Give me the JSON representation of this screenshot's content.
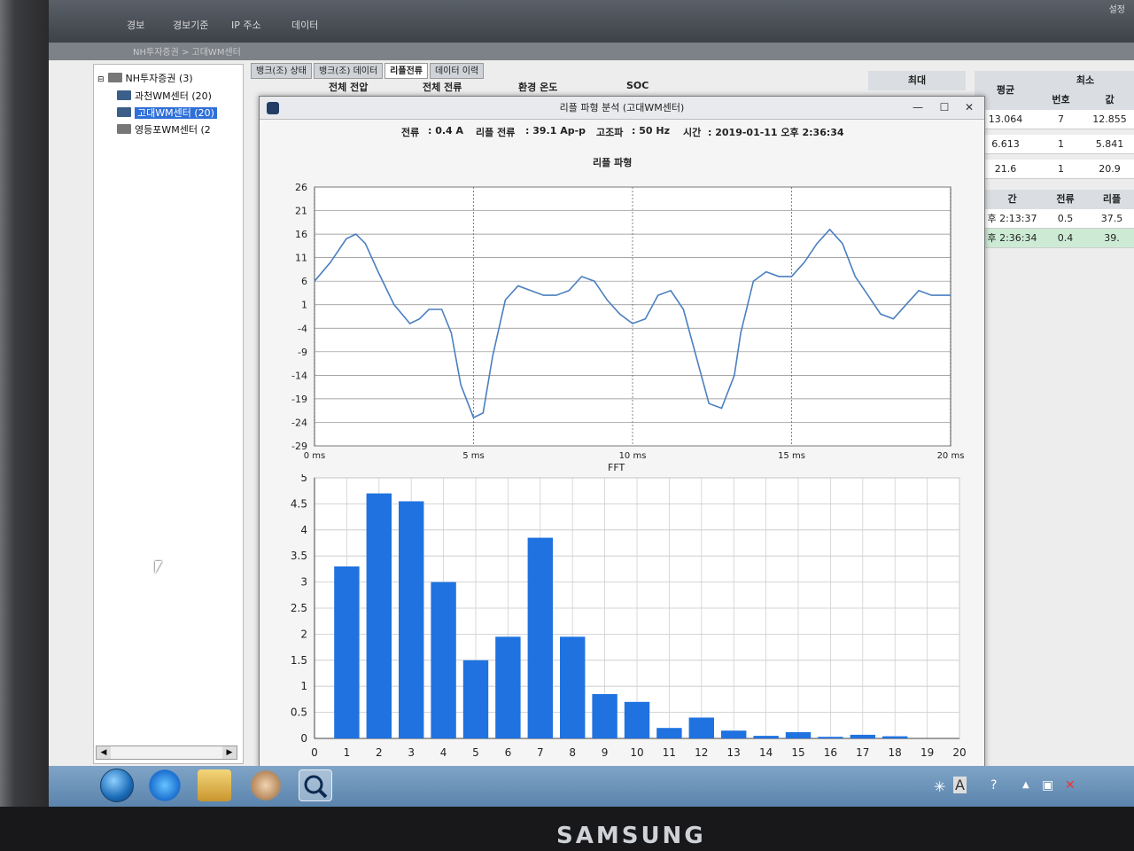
{
  "topbar": {
    "menu": [
      "경보",
      "경보기준",
      "IP 주소",
      "데이터"
    ],
    "settings": "설정"
  },
  "breadcrumb": "NH투자증권 > 고대WM센터",
  "tree": {
    "root": "NH투자증권 (3)",
    "children": [
      "과천WM센터 (20)",
      "고대WM센터 (20)",
      "영등포WM센터 (2"
    ]
  },
  "tabs": [
    "뱅크(조) 상태",
    "뱅크(조) 데이터",
    "리플전류",
    "데이터 이력"
  ],
  "column_headers": [
    "전체 전압",
    "전체 전류",
    "환경 온도",
    "SOC"
  ],
  "right_table": {
    "headers": [
      "최대",
      "평균",
      "최소",
      "번호",
      "값"
    ],
    "rows": [
      {
        "avg": "13.064",
        "no": "7",
        "val": "12.855"
      },
      {
        "avg": "6.613",
        "no": "1",
        "val": "5.841"
      },
      {
        "avg": "21.6",
        "no": "1",
        "val": "20.9"
      }
    ],
    "history_headers": [
      "간",
      "전류",
      "리플"
    ],
    "history_rows": [
      {
        "time": "후 2:13:37",
        "current": "0.5",
        "ripple": "37.5"
      },
      {
        "time": "후 2:36:34",
        "current": "0.4",
        "ripple": "39."
      }
    ]
  },
  "dialog": {
    "title": "리플 파형 분석 (고대WM센터)",
    "min": "—",
    "max": "☐",
    "close": "✕",
    "current_label": "전류",
    "current_value": ": 0.4 A",
    "ripple_label": "리플 전류",
    "ripple_value": ": 39.1 Ap-p",
    "harmonic_label": "고조파",
    "harmonic_value": ": 50 Hz",
    "time_label": "시간",
    "time_value": ": 2019-01-11 오후 2:36:34"
  },
  "chart_data": [
    {
      "type": "line",
      "title": "리플 파형",
      "xlabel": "",
      "ylabel": "",
      "x_ticks": [
        "0 ms",
        "5 ms",
        "10 ms",
        "15 ms",
        "20 ms"
      ],
      "y_ticks": [
        "26",
        "21",
        "16",
        "11",
        "6",
        "1",
        "-4",
        "-9",
        "-14",
        "-19",
        "-24",
        "-29"
      ],
      "xlim": [
        0,
        20
      ],
      "ylim": [
        -29,
        26
      ],
      "grid": true,
      "series": [
        {
          "x": [
            0,
            0.5,
            1,
            1.3,
            1.6,
            2,
            2.5,
            3,
            3.3,
            3.6,
            4,
            4.3,
            4.6,
            5,
            5.3,
            5.6,
            6,
            6.4,
            6.8,
            7.2,
            7.6,
            8,
            8.4,
            8.8,
            9.2,
            9.6,
            10,
            10.4,
            10.8,
            11.2,
            11.6,
            12,
            12.4,
            12.8,
            13.2,
            13.4,
            13.8,
            14.2,
            14.6,
            15,
            15.4,
            15.8,
            16.2,
            16.6,
            17,
            17.4,
            17.8,
            18.2,
            18.6,
            19,
            19.4,
            19.7,
            20
          ],
          "y": [
            6,
            10,
            15,
            16,
            14,
            8,
            1,
            -3,
            -2,
            0,
            0,
            -5,
            -16,
            -23,
            -22,
            -10,
            2,
            5,
            4,
            3,
            3,
            4,
            7,
            6,
            2,
            -1,
            -3,
            -2,
            3,
            4,
            0,
            -10,
            -20,
            -21,
            -14,
            -5,
            6,
            8,
            7,
            7,
            10,
            14,
            17,
            14,
            7,
            3,
            -1,
            -2,
            1,
            4,
            3,
            3,
            3
          ]
        }
      ]
    },
    {
      "type": "bar",
      "title": "FFT",
      "xlabel": "",
      "ylabel": "",
      "categories": [
        "1",
        "2",
        "3",
        "4",
        "5",
        "6",
        "7",
        "8",
        "9",
        "10",
        "11",
        "12",
        "13",
        "14",
        "15",
        "16",
        "17",
        "18",
        "19"
      ],
      "x_ticks": [
        "0",
        "1",
        "2",
        "3",
        "4",
        "5",
        "6",
        "7",
        "8",
        "9",
        "10",
        "11",
        "12",
        "13",
        "14",
        "15",
        "16",
        "17",
        "18",
        "19",
        "20"
      ],
      "y_ticks": [
        "5",
        "4.5",
        "4",
        "3.5",
        "3",
        "2.5",
        "2",
        "1.5",
        "1",
        "0.5",
        "0"
      ],
      "values": [
        3.3,
        4.7,
        4.55,
        3.0,
        1.5,
        1.95,
        3.85,
        1.95,
        0.85,
        0.7,
        0.2,
        0.4,
        0.15,
        0.05,
        0.12,
        0.03,
        0.07,
        0.04,
        0
      ],
      "ylim": [
        0,
        5
      ],
      "xlim": [
        0,
        20
      ],
      "grid": true,
      "color": "#1f72e0"
    }
  ]
}
